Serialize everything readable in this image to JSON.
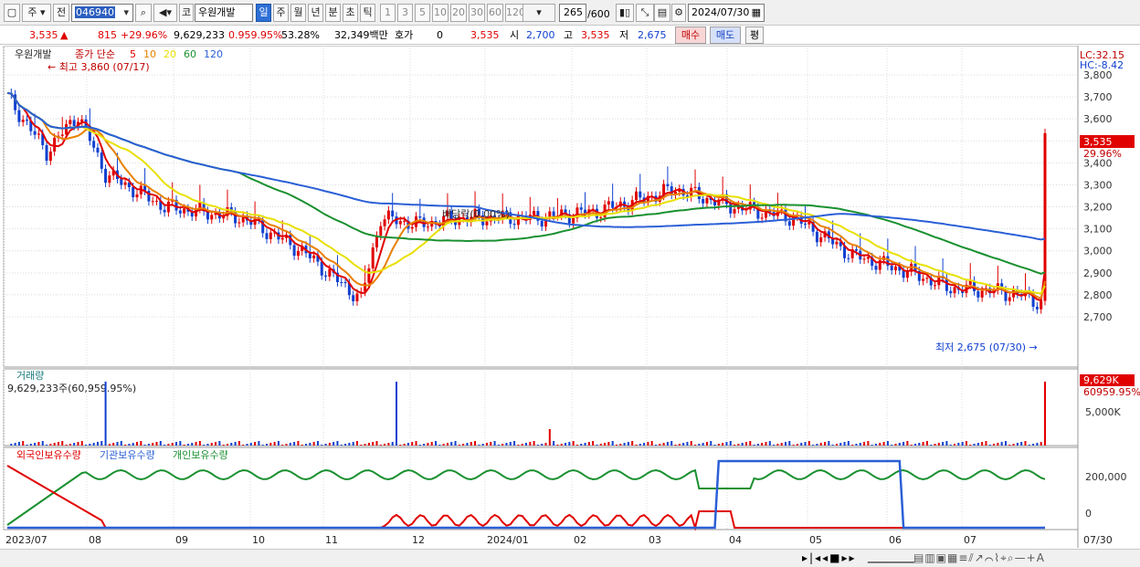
{
  "toolbar": {
    "market": "주",
    "prev": "전",
    "code": "046940",
    "market_badge": "코",
    "name": "우원개발",
    "period_tabs": [
      "일",
      "주",
      "월",
      "년",
      "분",
      "초",
      "틱"
    ],
    "selected_period": "일",
    "intervals": [
      "1",
      "3",
      "5",
      "10",
      "20",
      "30",
      "60",
      "120"
    ],
    "count": "265",
    "count_total": "/600",
    "date": "2024/07/30"
  },
  "quote": {
    "price": "3,535",
    "change": "815",
    "change_pct": "+29.96%",
    "volume": "9,629,233",
    "vol_pct": "0.959.95%",
    "turnover": "53.28%",
    "amount": "32,349백만",
    "hoga_label": "호가",
    "hoga_value": "0",
    "hoga_price": "3,535",
    "open_label": "시",
    "open": "2,700",
    "high_label": "고",
    "high": "3,535",
    "low_label": "저",
    "low": "2,675",
    "buy": "매수",
    "sell": "매도",
    "eval": "평"
  },
  "price_panel": {
    "title": "우원개발",
    "ma_label": "종가 단순",
    "ma_periods": [
      "5",
      "10",
      "20",
      "60",
      "120"
    ],
    "ma_colors": [
      "#e00000",
      "#e88000",
      "#e8e000",
      "#1a9030",
      "#2b5fd6"
    ],
    "high_note": "최고 3,860 (07/17)",
    "low_note": "최저 2,675 (07/30)",
    "dividend_note": "배당락(0.00%)",
    "lc": "LC:32.15",
    "hc": "HC:-8.42",
    "current_label": "3,535",
    "current_pct": "29.96%",
    "y_ticks": [
      "3,800",
      "3,700",
      "3,600",
      "3,500",
      "3,400",
      "3,300",
      "3,200",
      "3,100",
      "3,000",
      "2,900",
      "2,800",
      "2,700"
    ]
  },
  "volume_panel": {
    "title": "거래량",
    "value": "9,629,233주(60,959.95%)",
    "current_label": "9,629K",
    "current_pct": "60959.95%",
    "y_tick": "5,000K"
  },
  "holding_panel": {
    "legend": [
      "외국인보유수량",
      "기관보유수량",
      "개인보유수량"
    ],
    "legend_colors": [
      "#e00000",
      "#2b5fd6",
      "#1a9030"
    ],
    "y_ticks": [
      "200,000",
      "0"
    ]
  },
  "x_axis": {
    "labels": [
      "2023/07",
      "08",
      "09",
      "10",
      "11",
      "12",
      "2024/01",
      "02",
      "03",
      "04",
      "05",
      "06",
      "07"
    ],
    "last": "07/30"
  }
}
